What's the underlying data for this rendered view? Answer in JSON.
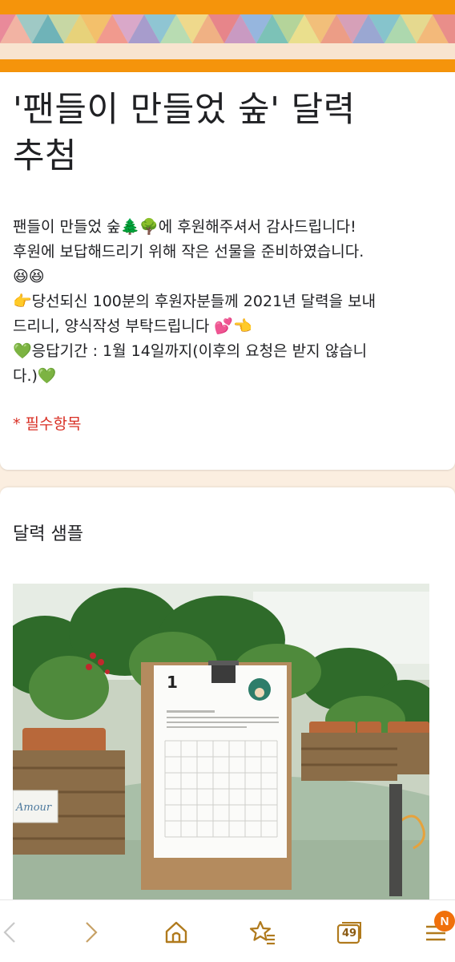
{
  "form": {
    "title_line1": "'팬들이 만들었 숲' 달력",
    "title_line2": "추첨",
    "description": {
      "line1": "팬들이 만들었 숲🌲🌳에 후원해주셔서 감사드립니다!",
      "line2": "후원에 보답해드리기 위해 작은 선물을 준비하였습니다.",
      "line3": "😆😆",
      "line4": "👉당선되신 100분의 후원자분들께 2021년 달력을 보내",
      "line5": "드리니, 양식작성 부탁드립니다 💕👈",
      "line6": "💚응답기간 : 1월 14일까지(이후의 요청은 받지 않습니",
      "line7": "다.)💚"
    },
    "required_note": "* 필수항목"
  },
  "section": {
    "title": "달력 샘플",
    "image": {
      "calendar_month": "1",
      "plant_tag_text": "Amour"
    }
  },
  "toolbar": {
    "tab_count": "49",
    "notification_badge": "N",
    "icons": [
      "chevron-left-icon",
      "chevron-right-icon",
      "home-icon",
      "star-list-icon",
      "tabs-icon",
      "menu-icon"
    ]
  },
  "colors": {
    "accent": "#f5940b",
    "required": "#d93025",
    "badge": "#f0700b",
    "toolbar_icon": "#b07a1d"
  }
}
